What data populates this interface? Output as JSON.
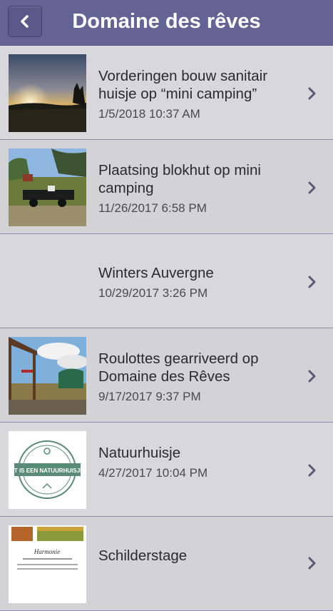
{
  "header": {
    "title": "Domaine des rêves",
    "back_icon": "chevron-left-icon"
  },
  "items": [
    {
      "title": "Vorderingen bouw sanitair huisje op “mini camping”",
      "date": "1/5/2018 10:37 AM",
      "thumb": "sunset"
    },
    {
      "title": "Plaatsing blokhut op mini camping",
      "date": "11/26/2017 6:58 PM",
      "thumb": "trailer"
    },
    {
      "title": "Winters Auvergne",
      "date": "10/29/2017 3:26 PM",
      "thumb": ""
    },
    {
      "title": "Roulottes gearriveerd op Domaine des Rêves",
      "date": "9/17/2017 9:37 PM",
      "thumb": "roulotte"
    },
    {
      "title": "Natuurhuisje",
      "date": "4/27/2017 10:04 PM",
      "thumb": "stamp"
    },
    {
      "title": "Schilderstage",
      "date": "",
      "thumb": "flyer"
    }
  ],
  "thumb_text": {
    "stamp": "DIT IS EEN NATUURHUISJE!",
    "flyer": "Harmonie"
  },
  "colors": {
    "navbar": "#646396",
    "row_bg": "#d8d8dc",
    "divider": "#8d8cb0",
    "chevron": "#5a5a78"
  }
}
